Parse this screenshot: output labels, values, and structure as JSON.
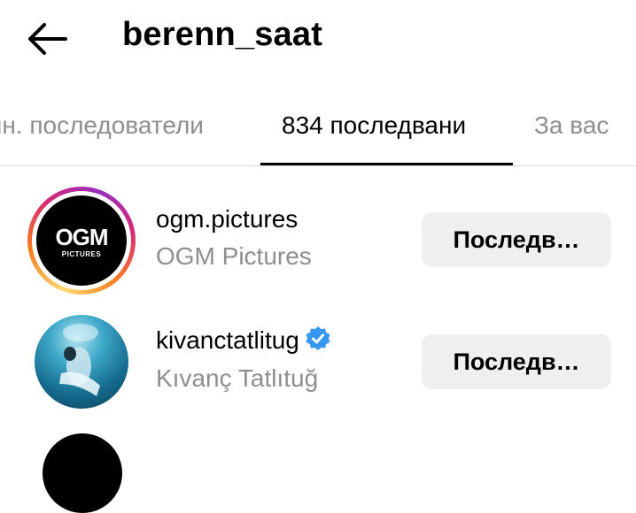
{
  "header": {
    "title": "berenn_saat",
    "back_icon": "arrow-left-icon"
  },
  "tabs": [
    {
      "label": "лн. последователи",
      "active": false
    },
    {
      "label": "834 последвани",
      "active": true
    },
    {
      "label": "За вас",
      "active": false
    }
  ],
  "following": [
    {
      "username": "ogm.pictures",
      "full_name": "OGM Pictures",
      "button": "Последв…",
      "verified": false,
      "avatar_text": "OGM",
      "avatar_subtext": "PICTURES",
      "story_ring": true
    },
    {
      "username": "kivanctatlitug",
      "full_name": "Kıvanç Tatlıtuğ",
      "button": "Последв…",
      "verified": true,
      "story_ring": false
    }
  ],
  "colors": {
    "verified_blue": "#3897f0",
    "button_bg": "#efefef",
    "muted_text": "#8e8e8e"
  }
}
